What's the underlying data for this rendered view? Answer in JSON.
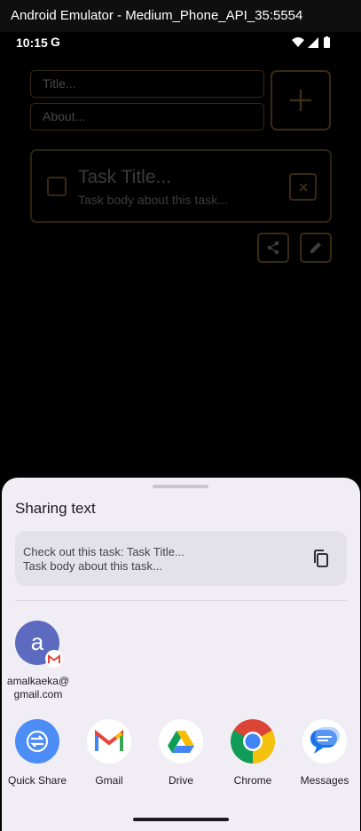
{
  "window": {
    "title": "Android Emulator - Medium_Phone_API_35:5554"
  },
  "status_bar": {
    "time": "10:15",
    "g_logo": "G",
    "icons": [
      "wifi-icon",
      "signal-icon",
      "battery-icon"
    ]
  },
  "app": {
    "title_placeholder": "Title...",
    "about_placeholder": "About...",
    "add_icon": "plus-icon",
    "task": {
      "title": "Task Title...",
      "body": "Task body about this task..."
    },
    "actions": [
      "share-icon",
      "edit-icon"
    ]
  },
  "share_sheet": {
    "title": "Sharing text",
    "preview_line1": "Check out this task: Task Title...",
    "preview_line2": "Task body about this task...",
    "contact": {
      "initial": "a",
      "name_line1": "amalkaeka@",
      "name_line2": "gmail.com"
    },
    "apps": [
      {
        "label": "Quick Share",
        "icon": "quick-share-icon"
      },
      {
        "label": "Gmail",
        "icon": "gmail-icon"
      },
      {
        "label": "Drive",
        "icon": "drive-icon"
      },
      {
        "label": "Chrome",
        "icon": "chrome-icon"
      },
      {
        "label": "Messages",
        "icon": "messages-icon"
      }
    ]
  },
  "colors": {
    "accent": "#3a2a12",
    "sheet_bg": "#f0eef4",
    "avatar": "#5c6bc0"
  }
}
